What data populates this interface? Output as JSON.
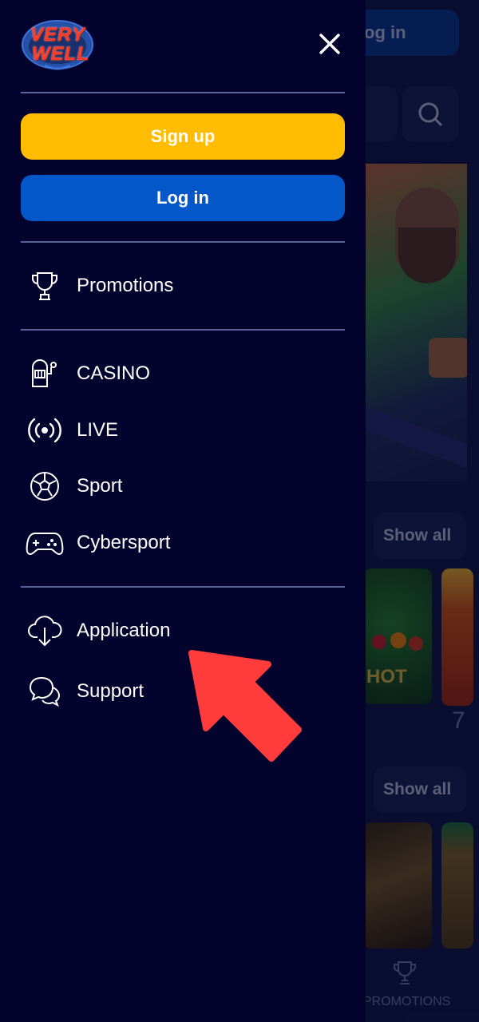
{
  "background": {
    "login_label": "og in",
    "rows": [
      {
        "show_all_label": "Show all"
      },
      {
        "show_all_label": "Show all"
      }
    ],
    "tile_hot_label": "HOT",
    "tile_partial_text": "7",
    "bottom_tab": {
      "label": "PROMOTIONS",
      "icon": "trophy-icon"
    }
  },
  "drawer": {
    "logo_text": {
      "line1": "VERY",
      "line2": "WELL"
    },
    "close_icon": "close-icon",
    "signup_label": "Sign up",
    "login_label": "Log in",
    "menu": [
      {
        "label": "Promotions",
        "icon": "trophy-icon"
      },
      {
        "label": "CASINO",
        "icon": "slot-machine-icon"
      },
      {
        "label": "LIVE",
        "icon": "live-broadcast-icon"
      },
      {
        "label": "Sport",
        "icon": "soccer-ball-icon"
      },
      {
        "label": "Cybersport",
        "icon": "gamepad-icon"
      },
      {
        "label": "Application",
        "icon": "cloud-download-icon"
      },
      {
        "label": "Support",
        "icon": "chat-bubbles-icon"
      }
    ]
  },
  "colors": {
    "drawer_bg": "#03032e",
    "signup": "#ffbc00",
    "login": "#0357c9",
    "arrow": "#ff3b3b"
  }
}
